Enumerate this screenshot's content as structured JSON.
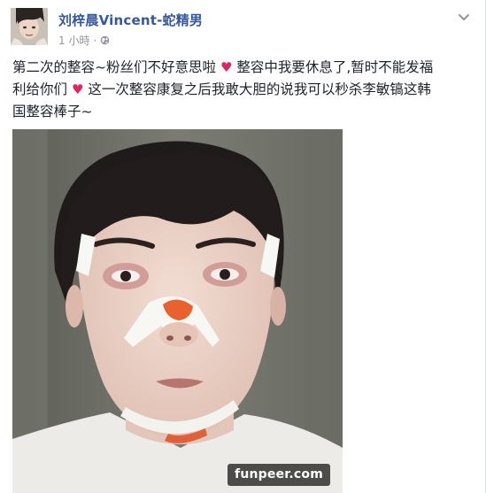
{
  "post": {
    "author_name": "刘梓晨Vincent-蛇精男",
    "timestamp": "1 小時",
    "separator": "·",
    "privacy_icon": "globe-icon",
    "menu_icon": "chevron-down-icon",
    "caption": {
      "line1_a": "第二次的整容~粉丝们不好意思啦",
      "line1_b": "整容中我要休息了,暂时不能发福",
      "line2_a": "利给你们",
      "line2_b": "这一次整容康复之后我敢大胆的说我可以秒杀李敏镐这韩",
      "line3": "国整容棒子~",
      "emoji": "♥"
    }
  },
  "watermark": {
    "text": "funpeer.com"
  },
  "colors": {
    "link_blue": "#365899",
    "meta_gray": "#90949c",
    "heart_red": "#e0245e",
    "text": "#1d2129"
  }
}
